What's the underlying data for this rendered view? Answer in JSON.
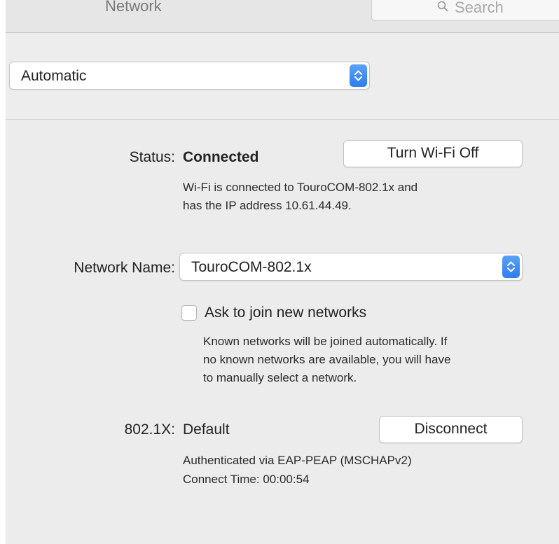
{
  "window": {
    "title": "Network",
    "search_placeholder": "Search"
  },
  "location": {
    "selected": "Automatic"
  },
  "status": {
    "label": "Status:",
    "value": "Connected",
    "toggle_button": "Turn Wi-Fi Off",
    "description_line1": "Wi-Fi is connected to TouroCOM-802.1x and",
    "description_line2": "has the IP address 10.61.44.49."
  },
  "network_name": {
    "label": "Network Name:",
    "selected": "TouroCOM-802.1x"
  },
  "ask_to_join": {
    "label": "Ask to join new networks",
    "checked": false,
    "help_line1": "Known networks will be joined automatically. If",
    "help_line2": "no known networks are available, you will have",
    "help_line3": "to manually select a network."
  },
  "dot1x": {
    "label": "802.1X:",
    "value": "Default",
    "disconnect_button": "Disconnect",
    "auth_line": "Authenticated via EAP-PEAP (MSCHAPv2)",
    "time_line": "Connect Time: 00:00:54"
  },
  "colors": {
    "accent": "#2f7cf0",
    "panel": "#ececec"
  }
}
